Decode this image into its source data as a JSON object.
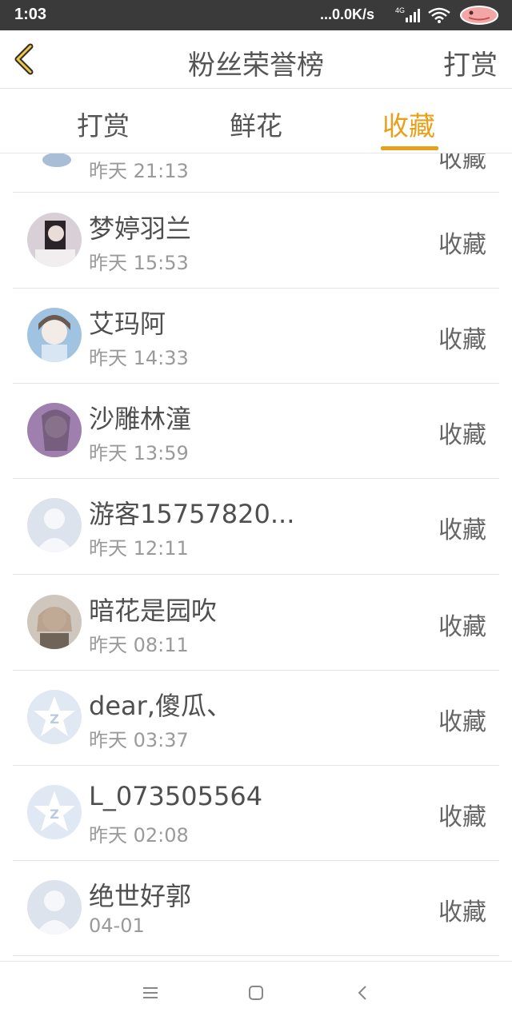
{
  "status_bar": {
    "time": "1:03",
    "net_speed": "...0.0K/s",
    "network_type": "4G",
    "icons": [
      "signal-icon",
      "wifi-icon",
      "battery-icon"
    ]
  },
  "header": {
    "title": "粉丝荣誉榜",
    "action_label": "打赏",
    "back_icon": "chevron-left-icon"
  },
  "tabs": [
    {
      "label": "打赏",
      "active": false
    },
    {
      "label": "鲜花",
      "active": false
    },
    {
      "label": "收藏",
      "active": true
    }
  ],
  "colors": {
    "accent": "#e9a019",
    "text": "#4f4f4f",
    "subtext": "#9a9a9a"
  },
  "list": {
    "partial_item": {
      "time": "昨天 21:13",
      "action": "收藏"
    },
    "items": [
      {
        "name": "梦婷羽兰",
        "time": "昨天 15:53",
        "action": "收藏",
        "avatar": "photo-dark"
      },
      {
        "name": "艾玛阿",
        "time": "昨天 14:33",
        "action": "收藏",
        "avatar": "anime-blue"
      },
      {
        "name": "沙雕林潼",
        "time": "昨天 13:59",
        "action": "收藏",
        "avatar": "photo-purple"
      },
      {
        "name": "游客15757820...",
        "time": "昨天 12:11",
        "action": "收藏",
        "avatar": "default-person"
      },
      {
        "name": "暗花是园吹",
        "time": "昨天 08:11",
        "action": "收藏",
        "avatar": "anime-doll"
      },
      {
        "name": "dear,傻瓜、",
        "time": "昨天 03:37",
        "action": "收藏",
        "avatar": "qq-star"
      },
      {
        "name": "L_073505564",
        "time": "昨天 02:08",
        "action": "收藏",
        "avatar": "qq-star"
      },
      {
        "name": "绝世好郭",
        "time": "04-01",
        "action": "收藏",
        "avatar": "default-person"
      }
    ]
  },
  "bottom_nav": [
    "menu-icon",
    "home-icon",
    "back-icon"
  ]
}
